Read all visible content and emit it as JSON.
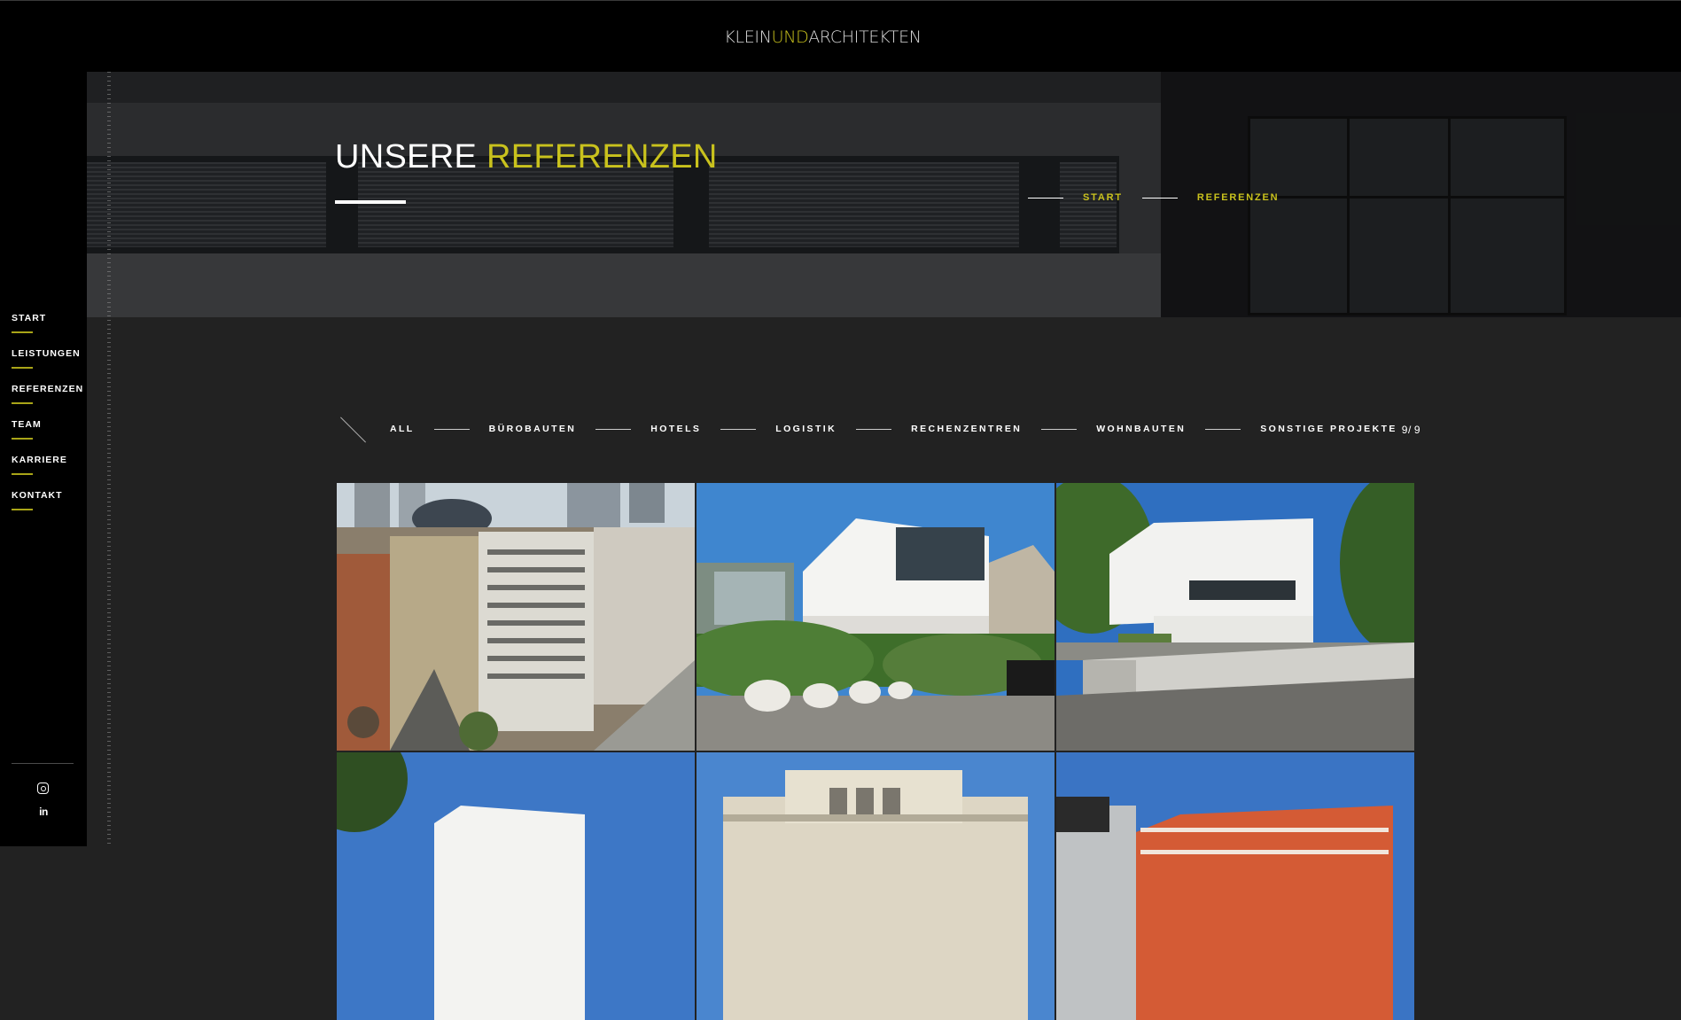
{
  "header": {
    "logo_part1": "KLEIN",
    "logo_part2": "UND",
    "logo_part3": "ARCHITEKTEN"
  },
  "sidebar": {
    "items": [
      {
        "label": "START"
      },
      {
        "label": "LEISTUNGEN"
      },
      {
        "label": "REFERENZEN"
      },
      {
        "label": "TEAM"
      },
      {
        "label": "KARRIERE"
      },
      {
        "label": "KONTAKT"
      }
    ],
    "social": {
      "instagram_icon": "instagram-icon",
      "linkedin_label": "in"
    }
  },
  "hero": {
    "title_white": "UNSERE",
    "title_accent": "REFERENZEN",
    "breadcrumb": [
      "START",
      "REFERENZEN"
    ]
  },
  "filters": {
    "items": [
      "ALL",
      "BÜROBAUTEN",
      "HOTELS",
      "LOGISTIK",
      "RECHENZENTREN",
      "WOHNBAUTEN",
      "SONSTIGE PROJEKTE"
    ],
    "counter_current": "9/",
    "counter_total": "9"
  },
  "colors": {
    "accent": "#c9c21d",
    "background": "#222222",
    "sidebar": "#000000"
  },
  "gallery": {
    "items": [
      {
        "name": "project-city-office-block"
      },
      {
        "name": "project-white-villa-1"
      },
      {
        "name": "project-white-villa-2"
      },
      {
        "name": "project-modern-building"
      },
      {
        "name": "project-classic-facade"
      },
      {
        "name": "project-orange-apartments"
      }
    ]
  }
}
